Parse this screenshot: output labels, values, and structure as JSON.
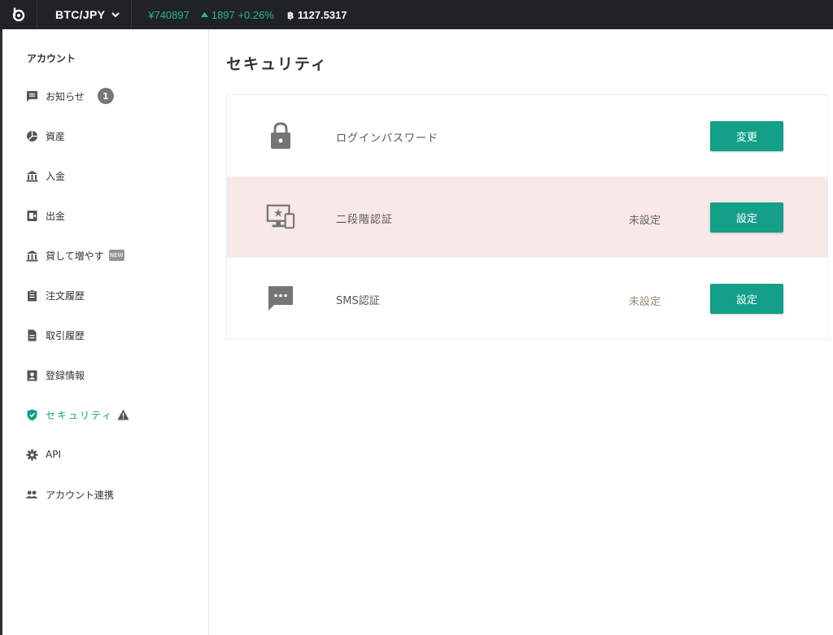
{
  "header": {
    "pair": "BTC/JPY",
    "price": "¥740897",
    "change": "1897 +0.26%",
    "btc_price": "1127.5317"
  },
  "sidebar": {
    "title": "アカウント",
    "items": [
      {
        "label": "お知らせ",
        "icon": "notice-icon",
        "badge": "1"
      },
      {
        "label": "資産",
        "icon": "assets-icon"
      },
      {
        "label": "入金",
        "icon": "bank-icon"
      },
      {
        "label": "出金",
        "icon": "withdraw-icon"
      },
      {
        "label": "貸して増やす",
        "icon": "bank-icon",
        "tag": "NEW"
      },
      {
        "label": "注文履歴",
        "icon": "clipboard-icon"
      },
      {
        "label": "取引履歴",
        "icon": "document-icon"
      },
      {
        "label": "登録情報",
        "icon": "profile-icon"
      },
      {
        "label": "セキュリティ",
        "icon": "shield-icon",
        "active": true,
        "warning": true
      },
      {
        "label": "API",
        "icon": "gear-icon"
      },
      {
        "label": "アカウント連携",
        "icon": "people-icon"
      }
    ]
  },
  "main": {
    "title": "セキュリティ",
    "rows": [
      {
        "label": "ログインパスワード",
        "status": "",
        "button": "変更",
        "icon": "lock-icon"
      },
      {
        "label": "二段階認証",
        "status": "未設定",
        "button": "設定",
        "icon": "device-icon"
      },
      {
        "label": "SMS認証",
        "status": "未設定",
        "button": "設定",
        "icon": "sms-icon"
      }
    ]
  },
  "colors": {
    "accent": "#139f88",
    "topbar": "#1f2227",
    "ticker_up": "#2bb58f",
    "warning_row": "#f8e8e8"
  }
}
